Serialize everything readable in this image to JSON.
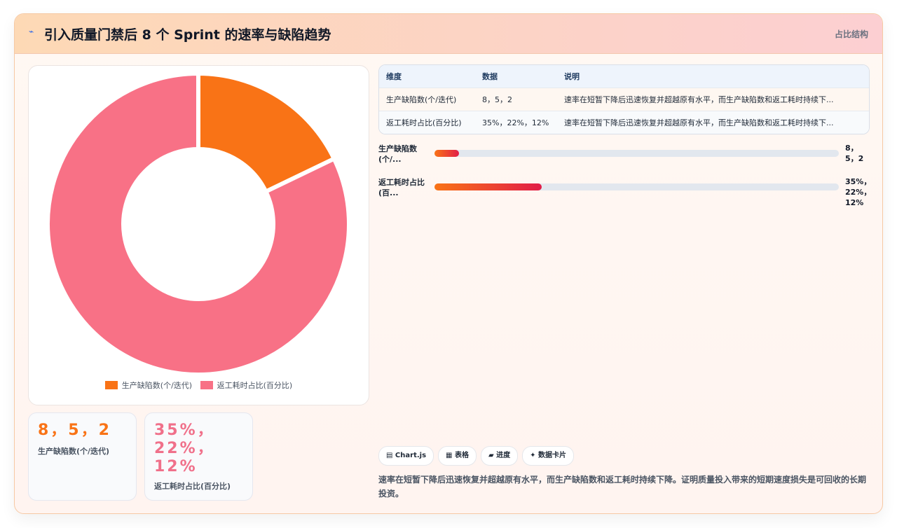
{
  "header": {
    "icon": "chart-line-icon",
    "title": "引入质量门禁后 8 个 Sprint 的速率与缺陷趋势",
    "tag": "占比结构"
  },
  "chart_data": {
    "type": "pie",
    "categories": [
      "生产缺陷数(个/迭代)",
      "返工耗时占比(百分比)"
    ],
    "values": [
      15,
      69
    ],
    "colors": [
      "#f97316",
      "#f87186"
    ],
    "donut": true,
    "legend_position": "bottom"
  },
  "stats": [
    {
      "value": "8，5，2",
      "label": "生产缺陷数(个/迭代)",
      "color": "#f97316"
    },
    {
      "value": "35%，22%，12%",
      "label": "返工耗时占比(百分比)",
      "color": "#f0708a"
    }
  ],
  "table": {
    "headers": [
      "维度",
      "数据",
      "说明"
    ],
    "rows": [
      [
        "生产缺陷数(个/迭代)",
        "8，5，2",
        "速率在短暂下降后迅速恢复并超越原有水平，而生产缺陷数和返工耗时持续下..."
      ],
      [
        "返工耗时占比(百分比)",
        "35%，22%，12%",
        "速率在短暂下降后迅速恢复并超越原有水平，而生产缺陷数和返工耗时持续下..."
      ]
    ]
  },
  "bars": [
    {
      "label": "生产缺陷数(个/...",
      "value": "8，5，2",
      "progress": 0.06
    },
    {
      "label": "返工耗时占比(百...",
      "value": "35%，22%，12%",
      "progress": 0.265
    }
  ],
  "chips": [
    "▤ Chart.js",
    "▦ 表格",
    "▰ 进度",
    "✦ 数据卡片"
  ],
  "footnote": "速率在短暂下降后迅速恢复并超越原有水平，而生产缺陷数和返工耗时持续下降。证明质量投入带来的短期速度损失是可回收的长期投资。"
}
